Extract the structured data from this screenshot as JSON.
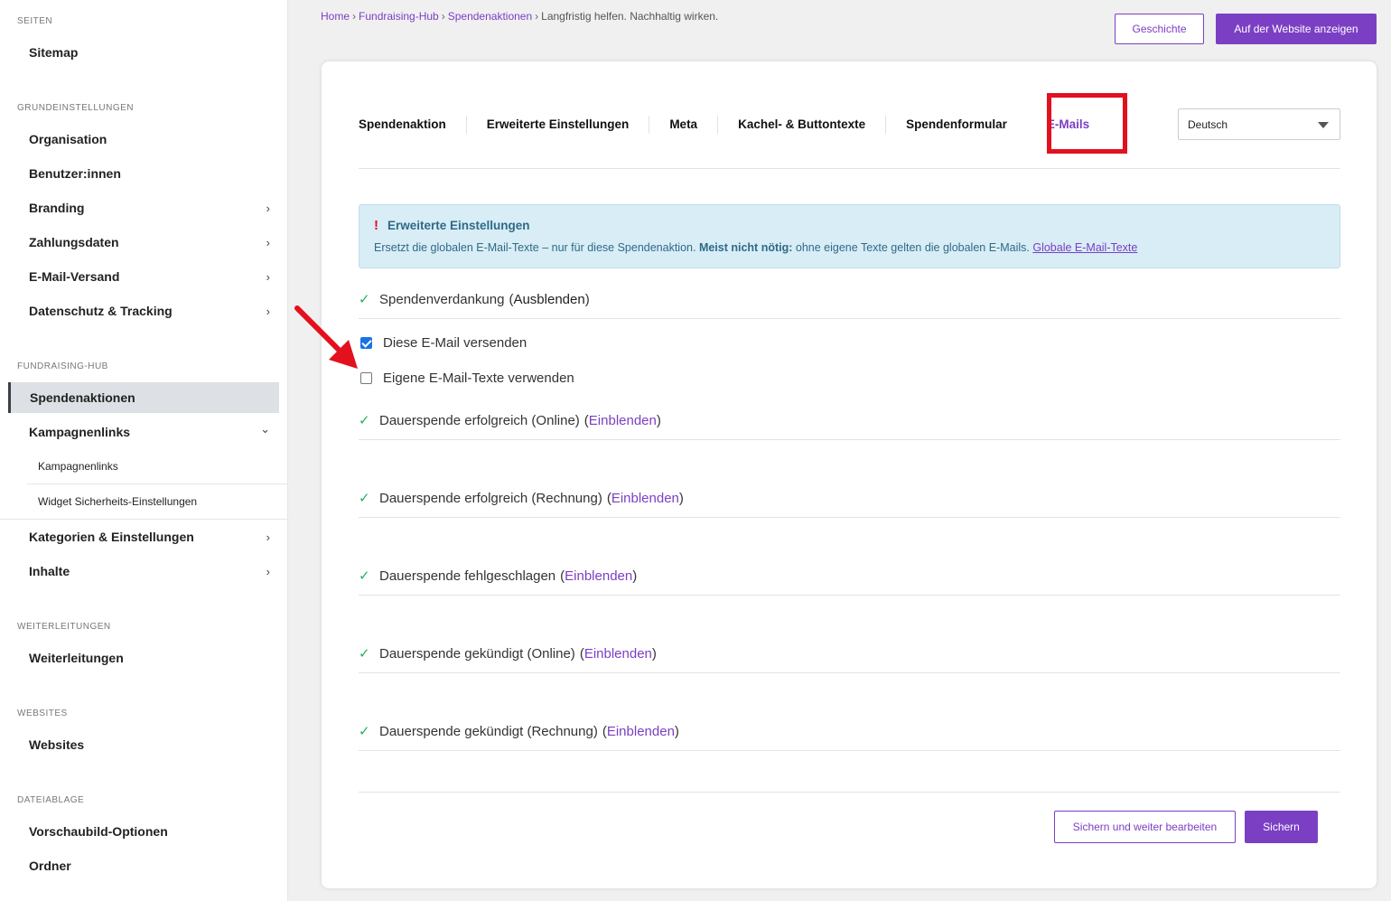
{
  "sidebar": {
    "sections": [
      {
        "heading": "SEITEN",
        "items": [
          {
            "label": "Sitemap"
          }
        ]
      },
      {
        "heading": "GRUNDEINSTELLUNGEN",
        "items": [
          {
            "label": "Organisation"
          },
          {
            "label": "Benutzer:innen"
          },
          {
            "label": "Branding",
            "chevron": "›"
          },
          {
            "label": "Zahlungsdaten",
            "chevron": "›"
          },
          {
            "label": "E-Mail-Versand",
            "chevron": "›"
          },
          {
            "label": "Datenschutz & Tracking",
            "chevron": "›"
          }
        ]
      },
      {
        "heading": "FUNDRAISING-HUB",
        "items": [
          {
            "label": "Spendenaktionen"
          },
          {
            "label": "Kampagnenlinks",
            "chevron": "⌄"
          },
          {
            "label": "Kampagnenlinks"
          },
          {
            "label": "Widget Sicherheits-Einstellungen"
          },
          {
            "label": "Kategorien & Einstellungen",
            "chevron": "›"
          },
          {
            "label": "Inhalte",
            "chevron": "›"
          }
        ]
      },
      {
        "heading": "WEITERLEITUNGEN",
        "items": [
          {
            "label": "Weiterleitungen"
          }
        ]
      },
      {
        "heading": "WEBSITES",
        "items": [
          {
            "label": "Websites"
          }
        ]
      },
      {
        "heading": "DATEIABLAGE",
        "items": [
          {
            "label": "Vorschaubild-Optionen"
          },
          {
            "label": "Ordner"
          }
        ]
      }
    ]
  },
  "breadcrumb": {
    "items": [
      "Home",
      "Fundraising-Hub",
      "Spendenaktionen"
    ],
    "current": "Langfristig helfen. Nachhaltig wirken.",
    "separator": "›"
  },
  "header_buttons": {
    "history": "Geschichte",
    "view_on_site": "Auf der Website anzeigen"
  },
  "tabs": [
    "Spendenaktion",
    "Erweiterte Einstellungen",
    "Meta",
    "Kachel- & Buttontexte",
    "Spendenformular",
    "E-Mails"
  ],
  "active_tab": "E-Mails",
  "language_select": {
    "value": "Deutsch"
  },
  "alert": {
    "icon": "!",
    "title": "Erweiterte Einstellungen",
    "text_prefix": "Ersetzt die globalen E-Mail-Texte – nur für diese Spendenaktion. ",
    "text_bold": "Meist nicht nötig:",
    "text_suffix": " ohne eigene Texte gelten die globalen E-Mails. ",
    "link": "Globale E-Mail-Texte"
  },
  "emails": [
    {
      "name": "Spendenverdankung",
      "toggle": "Ausblenden",
      "expanded": true
    },
    {
      "name": "Dauerspende erfolgreich (Online)",
      "toggle": "Einblenden",
      "expanded": false
    },
    {
      "name": "Dauerspende erfolgreich (Rechnung)",
      "toggle": "Einblenden",
      "expanded": false
    },
    {
      "name": "Dauerspende fehlgeschlagen",
      "toggle": "Einblenden",
      "expanded": false
    },
    {
      "name": "Dauerspende gekündigt (Online)",
      "toggle": "Einblenden",
      "expanded": false
    },
    {
      "name": "Dauerspende gekündigt (Rechnung)",
      "toggle": "Einblenden",
      "expanded": false
    }
  ],
  "checkbox_options": [
    {
      "label": "Diese E-Mail versenden",
      "checked": true
    },
    {
      "label": "Eigene E-Mail-Texte verwenden",
      "checked": false
    }
  ],
  "footer_buttons": {
    "save_continue": "Sichern und weiter bearbeiten",
    "save": "Sichern"
  },
  "colors": {
    "accent": "#7b3fc4",
    "check_green": "#27ae60",
    "highlight_red": "#e3101e",
    "alert_bg": "#d8edf5",
    "checkbox_blue": "#1a73e8"
  }
}
